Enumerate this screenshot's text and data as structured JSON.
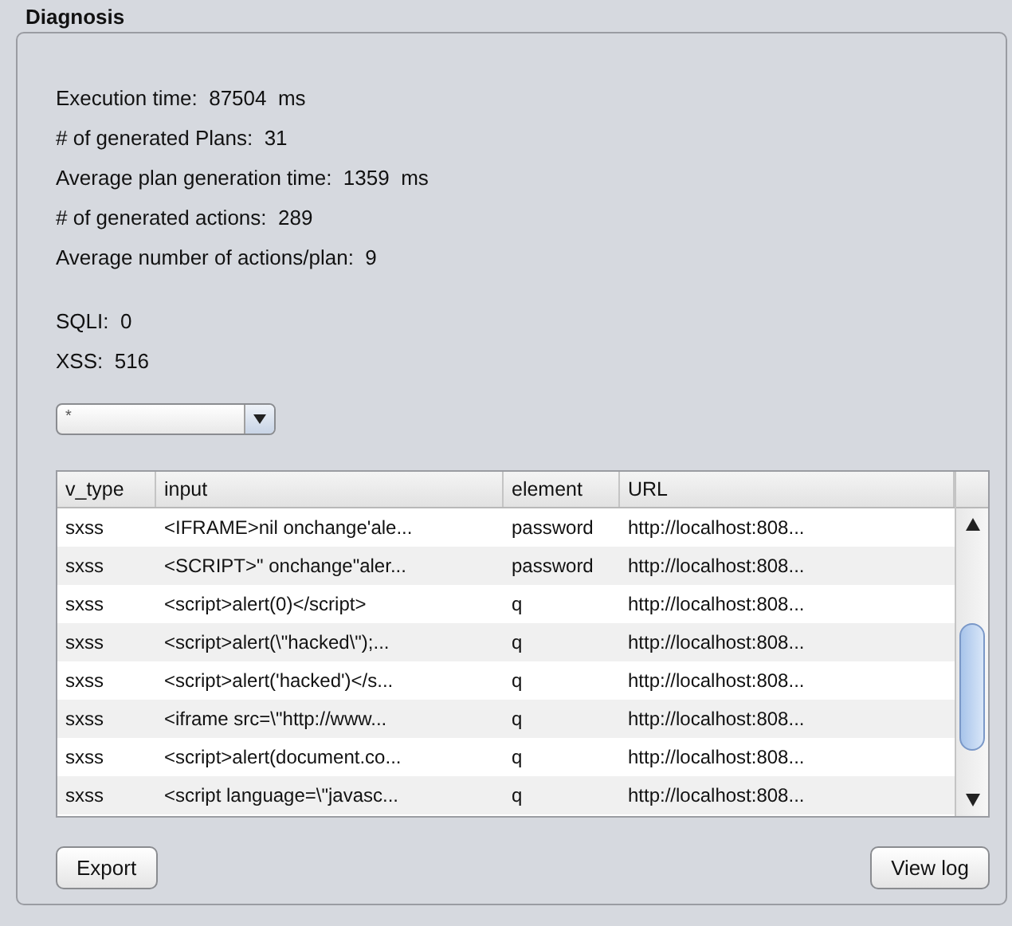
{
  "title": "Diagnosis",
  "stats": [
    "Execution time:  87504  ms",
    "# of generated Plans:  31",
    "Average plan generation time:  1359  ms",
    "# of generated actions:  289",
    "Average number of actions/plan:  9"
  ],
  "counts": [
    "SQLI:  0",
    "XSS:  516"
  ],
  "filter": {
    "value": "*"
  },
  "table": {
    "columns": [
      "v_type",
      "input",
      "element",
      "URL"
    ],
    "rows": [
      [
        "sxss",
        "<IFRAME>nil onchange'ale...",
        "password",
        "http://localhost:808..."
      ],
      [
        "sxss",
        "<SCRIPT>\" onchange\"aler...",
        "password",
        "http://localhost:808..."
      ],
      [
        "sxss",
        "<script>alert(0)</script>",
        "q",
        "http://localhost:808..."
      ],
      [
        "sxss",
        "<script>alert(\\\"hacked\\\");...",
        "q",
        "http://localhost:808..."
      ],
      [
        "sxss",
        "<script>alert('hacked')</s...",
        "q",
        "http://localhost:808..."
      ],
      [
        "sxss",
        "<iframe src=\\\"http://www...",
        "q",
        "http://localhost:808..."
      ],
      [
        "sxss",
        "<script>alert(document.co...",
        "q",
        "http://localhost:808..."
      ],
      [
        "sxss",
        "<script language=\\\"javasc...",
        "q",
        "http://localhost:808..."
      ]
    ]
  },
  "buttons": {
    "left": "Export",
    "right": "View log"
  }
}
